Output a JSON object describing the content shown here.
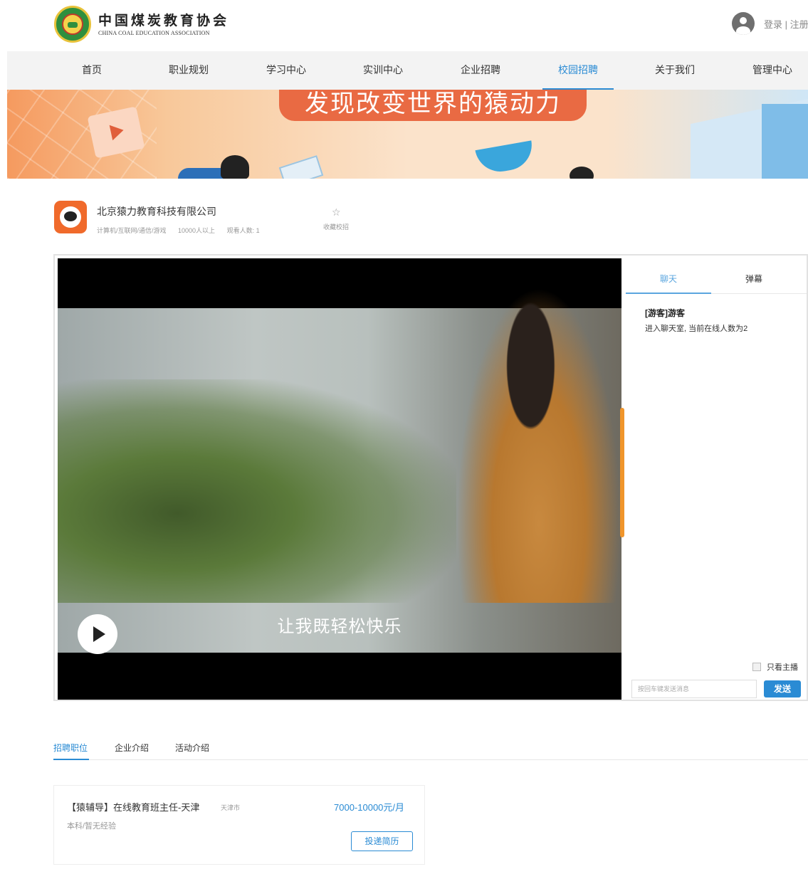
{
  "header": {
    "brand_cn": "中国煤炭教育协会",
    "brand_en": "CHINA COAL EDUCATION ASSOCIATION",
    "auth_text": "登录 | 注册"
  },
  "nav": {
    "items": [
      {
        "label": "首页"
      },
      {
        "label": "职业规划"
      },
      {
        "label": "学习中心"
      },
      {
        "label": "实训中心"
      },
      {
        "label": "企业招聘"
      },
      {
        "label": "校园招聘"
      },
      {
        "label": "关于我们"
      },
      {
        "label": "管理中心"
      }
    ],
    "active": "校园招聘"
  },
  "banner": {
    "slogan": "发现改变世界的猿动力"
  },
  "company": {
    "name": "北京猿力教育科技有限公司",
    "industry": "计算机/互联网/通信/游戏",
    "size": "10000人以上",
    "viewers": "观看人数: 1",
    "favorite_label": "收藏校招"
  },
  "video": {
    "subtitle": "让我既轻松快乐",
    "playing": false
  },
  "chat": {
    "tabs": [
      "聊天",
      "弹幕"
    ],
    "active_tab": "聊天",
    "messages": [
      {
        "user": "[游客]游客",
        "text": "进入聊天室, 当前在线人数为2"
      }
    ],
    "host_only_label": "只看主播",
    "host_only_checked": false,
    "input_placeholder": "按回车键发送消息",
    "send_label": "发送"
  },
  "section_tabs": {
    "items": [
      "招聘职位",
      "企业介绍",
      "活动介绍"
    ],
    "active": "招聘职位"
  },
  "jobs": [
    {
      "title": "【猿辅导】在线教育班主任-天津",
      "city": "天津市",
      "salary": "7000-10000元/月",
      "requirements": "本科/暂无经验",
      "apply_label": "投递简历"
    }
  ],
  "colors": {
    "accent": "#2a8bd4",
    "company_orange": "#f06a2b",
    "banner_pill": "#e96a43",
    "video_progress": "#f0952b"
  }
}
